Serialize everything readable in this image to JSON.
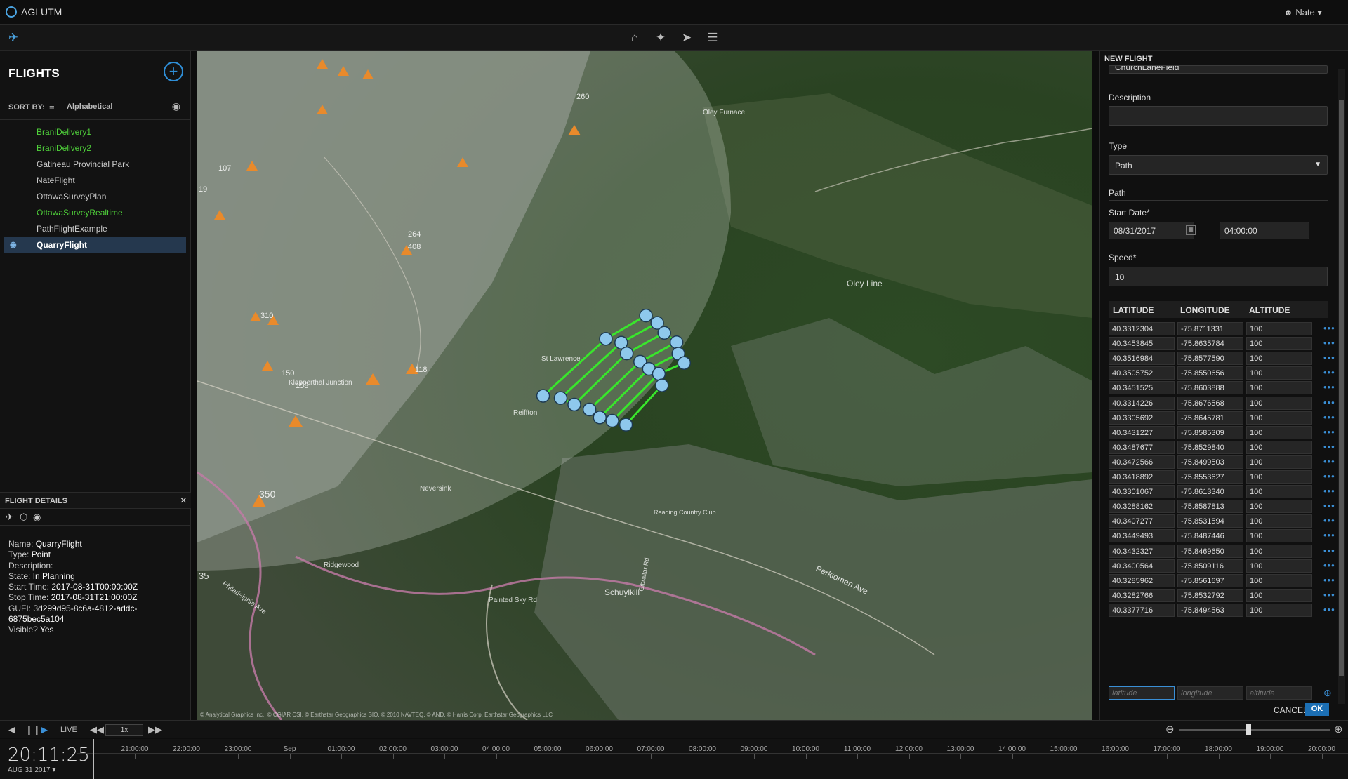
{
  "app": {
    "title": "AGI UTM",
    "user": "Nate"
  },
  "toolbar": {
    "icons": [
      "home-icon",
      "pin-icon",
      "navigate-icon",
      "layers-icon"
    ]
  },
  "flights": {
    "title": "FLIGHTS",
    "sort_label": "SORT BY:",
    "sort_value": "Alphabetical",
    "items": [
      {
        "name": "BraniDelivery1",
        "status": "green"
      },
      {
        "name": "BraniDelivery2",
        "status": "green"
      },
      {
        "name": "Gatineau Provincial Park",
        "status": "normal"
      },
      {
        "name": "NateFlight",
        "status": "normal"
      },
      {
        "name": "OttawaSurveyPlan",
        "status": "normal"
      },
      {
        "name": "OttawaSurveyRealtime",
        "status": "green"
      },
      {
        "name": "PathFlightExample",
        "status": "normal"
      },
      {
        "name": "QuarryFlight",
        "status": "selected"
      }
    ]
  },
  "details": {
    "title": "FLIGHT DETAILS",
    "name_label": "Name:",
    "name": "QuarryFlight",
    "type_label": "Type:",
    "type": "Point",
    "desc_label": "Description:",
    "desc": "",
    "state_label": "State:",
    "state": "In Planning",
    "start_label": "Start Time:",
    "start": "2017-08-31T00:00:00Z",
    "stop_label": "Stop Time:",
    "stop": "2017-08-31T21:00:00Z",
    "gufi_label": "GUFI:",
    "gufi": "3d299d95-8c6a-4812-addc-6875bec5a104",
    "visible_label": "Visible?",
    "visible": "Yes"
  },
  "new_flight": {
    "title": "NEW FLIGHT",
    "name_partial": "ChurchLaneField",
    "description_label": "Description",
    "description_value": "",
    "type_label": "Type",
    "type_value": "Path",
    "path_label": "Path",
    "start_label": "Start Date*",
    "start_date": "08/31/2017",
    "start_time": "04:00:00",
    "speed_label": "Speed*",
    "speed_value": "10",
    "columns": [
      "LATITUDE",
      "LONGITUDE",
      "ALTITUDE"
    ],
    "placeholders": {
      "lat": "latitude",
      "lon": "longitude",
      "alt": "altitude"
    },
    "cancel": "CANCEL",
    "ok": "OK"
  },
  "waypoints": [
    [
      "40.3312304",
      "-75.8711331",
      "100"
    ],
    [
      "40.3453845",
      "-75.8635784",
      "100"
    ],
    [
      "40.3516984",
      "-75.8577590",
      "100"
    ],
    [
      "40.3505752",
      "-75.8550656",
      "100"
    ],
    [
      "40.3451525",
      "-75.8603888",
      "100"
    ],
    [
      "40.3314226",
      "-75.8676568",
      "100"
    ],
    [
      "40.3305692",
      "-75.8645781",
      "100"
    ],
    [
      "40.3431227",
      "-75.8585309",
      "100"
    ],
    [
      "40.3487677",
      "-75.8529840",
      "100"
    ],
    [
      "40.3472566",
      "-75.8499503",
      "100"
    ],
    [
      "40.3418892",
      "-75.8553627",
      "100"
    ],
    [
      "40.3301067",
      "-75.8613340",
      "100"
    ],
    [
      "40.3288162",
      "-75.8587813",
      "100"
    ],
    [
      "40.3407277",
      "-75.8531594",
      "100"
    ],
    [
      "40.3449493",
      "-75.8487446",
      "100"
    ],
    [
      "40.3432327",
      "-75.8469650",
      "100"
    ],
    [
      "40.3400564",
      "-75.8509116",
      "100"
    ],
    [
      "40.3285962",
      "-75.8561697",
      "100"
    ],
    [
      "40.3282766",
      "-75.8532792",
      "100"
    ],
    [
      "40.3377716",
      "-75.8494563",
      "100"
    ]
  ],
  "time": {
    "live": "LIVE",
    "speed": "1x",
    "clock": "20:11:25",
    "date": "AUG 31 2017",
    "ticks": [
      "21:00:00",
      "22:00:00",
      "23:00:00",
      "Sep",
      "01:00:00",
      "02:00:00",
      "03:00:00",
      "04:00:00",
      "05:00:00",
      "06:00:00",
      "07:00:00",
      "08:00:00",
      "09:00:00",
      "10:00:00",
      "11:00:00",
      "12:00:00",
      "13:00:00",
      "14:00:00",
      "15:00:00",
      "16:00:00",
      "17:00:00",
      "18:00:00",
      "19:00:00",
      "20:00:00"
    ]
  },
  "map": {
    "labels": [
      "Oley Line",
      "St Lawrence",
      "Reiffton",
      "Neversink",
      "Perkiomen Ave",
      "Schuylkill",
      "Ridgewood",
      "Philadelphia Ave",
      "Klapperthal Junction",
      "Reading Country Club",
      "Oley Furnace",
      "Painted Sky Rd",
      "Gibraltar Rd"
    ],
    "markers": [
      "260",
      "264",
      "408",
      "310",
      "118",
      "350",
      "150",
      "158",
      "107",
      "19",
      "35"
    ],
    "attribution": "© Analytical Graphics Inc., © CGIAR CSI, © Earthstar Geographics SIO, © 2010 NAVTEQ, © AND, © Harris Corp, Earthstar Geographics LLC"
  }
}
